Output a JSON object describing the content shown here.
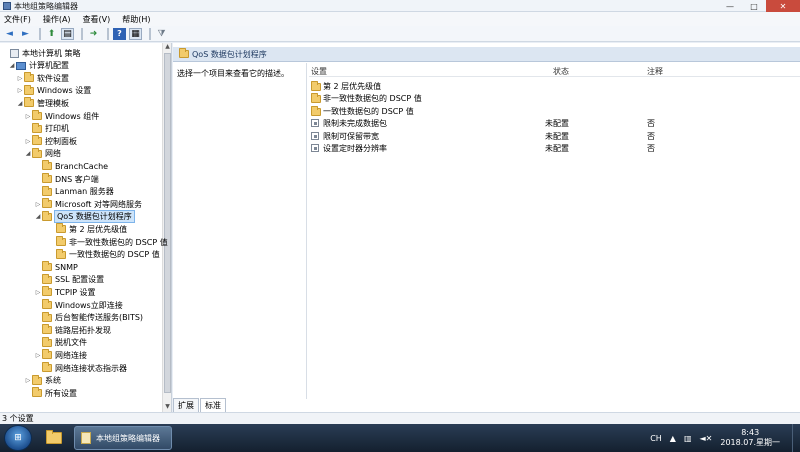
{
  "window": {
    "title": "本地组策略编辑器",
    "controls": {
      "minimize": "—",
      "maximize": "□",
      "close": "✕"
    }
  },
  "menu": [
    "文件(F)",
    "操作(A)",
    "查看(V)",
    "帮助(H)"
  ],
  "toolbar": {
    "back": "◄",
    "forward": "►",
    "up": "⬆",
    "show_hide": "▤",
    "export": "➜",
    "help": "?",
    "properties": "▦",
    "filter": "⧩"
  },
  "tree": [
    {
      "label": "本地计算机 策略",
      "depth": 0,
      "icon": "policy",
      "twisty": ""
    },
    {
      "label": "计算机配置",
      "depth": 1,
      "icon": "pc",
      "twisty": "◢"
    },
    {
      "label": "软件设置",
      "depth": 2,
      "icon": "folder",
      "twisty": "▷"
    },
    {
      "label": "Windows 设置",
      "depth": 2,
      "icon": "folder",
      "twisty": "▷"
    },
    {
      "label": "管理模板",
      "depth": 2,
      "icon": "folder",
      "twisty": "◢"
    },
    {
      "label": "Windows 组件",
      "depth": 3,
      "icon": "folder",
      "twisty": "▷"
    },
    {
      "label": "打印机",
      "depth": 3,
      "icon": "folder",
      "twisty": ""
    },
    {
      "label": "控制面板",
      "depth": 3,
      "icon": "folder",
      "twisty": "▷"
    },
    {
      "label": "网络",
      "depth": 3,
      "icon": "folder",
      "twisty": "◢"
    },
    {
      "label": "BranchCache",
      "depth": 4,
      "icon": "folder",
      "twisty": ""
    },
    {
      "label": "DNS 客户端",
      "depth": 4,
      "icon": "folder",
      "twisty": ""
    },
    {
      "label": "Lanman 服务器",
      "depth": 4,
      "icon": "folder",
      "twisty": ""
    },
    {
      "label": "Microsoft 对等网络服务",
      "depth": 4,
      "icon": "folder",
      "twisty": "▷"
    },
    {
      "label": "QoS 数据包计划程序",
      "depth": 4,
      "icon": "folder",
      "twisty": "◢",
      "selected": true
    },
    {
      "label": "第 2 层优先级值",
      "depth": 5,
      "icon": "folder",
      "twisty": ""
    },
    {
      "label": "非一致性数据包的 DSCP 值",
      "depth": 5,
      "icon": "folder",
      "twisty": ""
    },
    {
      "label": "一致性数据包的 DSCP 值",
      "depth": 5,
      "icon": "folder",
      "twisty": ""
    },
    {
      "label": "SNMP",
      "depth": 4,
      "icon": "folder",
      "twisty": ""
    },
    {
      "label": "SSL 配置设置",
      "depth": 4,
      "icon": "folder",
      "twisty": ""
    },
    {
      "label": "TCPIP 设置",
      "depth": 4,
      "icon": "folder",
      "twisty": "▷"
    },
    {
      "label": "Windows立即连接",
      "depth": 4,
      "icon": "folder",
      "twisty": ""
    },
    {
      "label": "后台智能传送服务(BITS)",
      "depth": 4,
      "icon": "folder",
      "twisty": ""
    },
    {
      "label": "链路层拓扑发现",
      "depth": 4,
      "icon": "folder",
      "twisty": ""
    },
    {
      "label": "脱机文件",
      "depth": 4,
      "icon": "folder",
      "twisty": ""
    },
    {
      "label": "网络连接",
      "depth": 4,
      "icon": "folder",
      "twisty": "▷"
    },
    {
      "label": "网络连接状态指示器",
      "depth": 4,
      "icon": "folder",
      "twisty": ""
    },
    {
      "label": "系统",
      "depth": 3,
      "icon": "folder",
      "twisty": "▷"
    },
    {
      "label": "所有设置",
      "depth": 3,
      "icon": "folder",
      "twisty": ""
    }
  ],
  "main": {
    "header": "QoS 数据包计划程序",
    "description": "选择一个项目来查看它的描述。",
    "columns": {
      "setting": "设置",
      "state": "状态",
      "comment": "注释"
    },
    "rows": [
      {
        "type": "folder",
        "setting": "第 2 层优先级值",
        "state": "",
        "comment": ""
      },
      {
        "type": "folder",
        "setting": "非一致性数据包的 DSCP 值",
        "state": "",
        "comment": ""
      },
      {
        "type": "folder",
        "setting": "一致性数据包的 DSCP 值",
        "state": "",
        "comment": ""
      },
      {
        "type": "setting",
        "setting": "限制未完成数据包",
        "state": "未配置",
        "comment": "否"
      },
      {
        "type": "setting",
        "setting": "限制可保留带宽",
        "state": "未配置",
        "comment": "否"
      },
      {
        "type": "setting",
        "setting": "设置定时器分辨率",
        "state": "未配置",
        "comment": "否"
      }
    ],
    "tabs": [
      "扩展",
      "标准"
    ]
  },
  "status": "3 个设置",
  "taskbar": {
    "app_label": "本地组策略编辑器",
    "lang": "CH",
    "time": "8:43",
    "date": "2018.07.星期一"
  }
}
